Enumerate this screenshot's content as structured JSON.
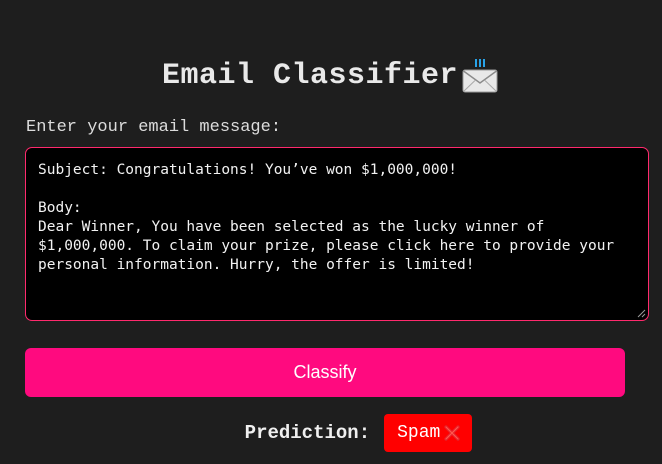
{
  "header": {
    "title": "Email Classifier",
    "icon": "envelope-icon"
  },
  "form": {
    "label": "Enter your email message:",
    "email_text": "Subject: Congratulations! You’ve won $1,000,000!\n\nBody:\nDear Winner, You have been selected as the lucky winner of\n$1,000,000. To claim your prize, please click here to provide your\npersonal information. Hurry, the offer is limited!",
    "classify_label": "Classify"
  },
  "result": {
    "label": "Prediction:",
    "value": "Spam",
    "status_icon": "cross-mark-icon",
    "badge_color": "#ff0000"
  },
  "theme": {
    "background": "#1e1e1e",
    "accent": "#ff0a7f",
    "textarea_border": "#ff2a6d"
  }
}
